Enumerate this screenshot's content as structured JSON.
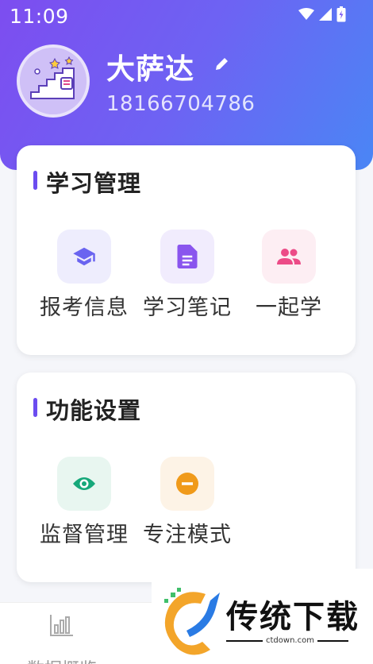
{
  "status_bar": {
    "time": "11:09"
  },
  "profile": {
    "name": "大萨达",
    "phone": "18166704786"
  },
  "learning_section": {
    "title": "学习管理",
    "items": [
      {
        "label": "报考信息",
        "icon": "graduation-cap-icon",
        "tile_color": "#eeedfd",
        "icon_color": "#6a64f0"
      },
      {
        "label": "学习笔记",
        "icon": "document-icon",
        "tile_color": "#f1ecfd",
        "icon_color": "#8a55ee"
      },
      {
        "label": "一起学",
        "icon": "people-icon",
        "tile_color": "#fdeef3",
        "icon_color": "#ec4b87"
      }
    ]
  },
  "function_section": {
    "title": "功能设置",
    "items": [
      {
        "label": "监督管理",
        "icon": "eye-icon",
        "tile_color": "#e8f6f0",
        "icon_color": "#16a87a"
      },
      {
        "label": "专注模式",
        "icon": "minus-circle-icon",
        "tile_color": "#fdf3e6",
        "icon_color": "#f09a1a"
      }
    ]
  },
  "tab_bar": {
    "items": [
      {
        "label": "数据概览",
        "icon": "bar-chart-icon"
      }
    ]
  },
  "watermark": {
    "brand": "传统下载",
    "url": "ctdown.com"
  },
  "colors": {
    "header_start": "#7d4df0",
    "header_end": "#4a86f5",
    "accent": "#6b4cf0"
  }
}
